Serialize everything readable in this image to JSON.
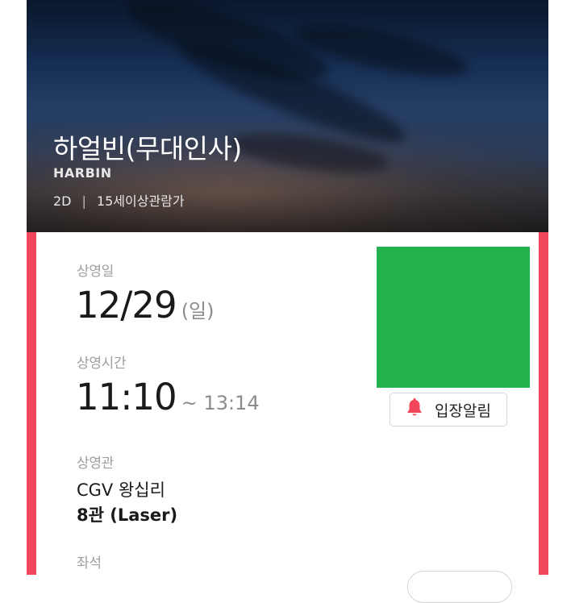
{
  "movie": {
    "title": "하얼빈(무대인사)",
    "original_title": "HARBIN",
    "format": "2D",
    "rating": "15세이상관람가"
  },
  "schedule": {
    "date_label": "상영일",
    "date": "12/29",
    "weekday": "(일)",
    "time_label": "상영시간",
    "start_time": "11:10",
    "end_time": "~ 13:14",
    "theater_label": "상영관",
    "theater_name": "CGV 왕십리",
    "hall": "8관 (Laser)",
    "seat_label": "좌석"
  },
  "actions": {
    "notify_label": "입장알림"
  },
  "icons": {
    "notify": "bell-icon"
  },
  "colors": {
    "accent": "#f2475b",
    "poster_placeholder": "#22b14c"
  }
}
